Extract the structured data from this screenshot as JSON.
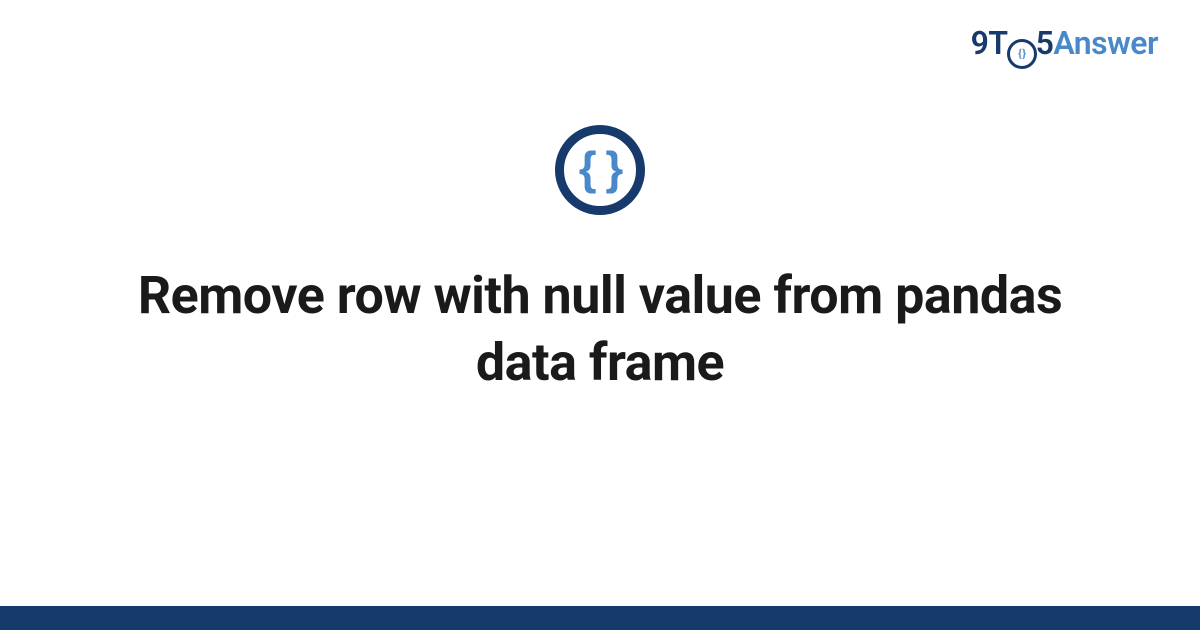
{
  "brand": {
    "part1": "9T",
    "ring_inner": "{ }",
    "part2": "5",
    "part3": "Answer"
  },
  "icon": {
    "braces": "{ }"
  },
  "title": "Remove row with null value from pandas data frame",
  "colors": {
    "dark_blue": "#163a6b",
    "light_blue": "#4a89c9"
  }
}
